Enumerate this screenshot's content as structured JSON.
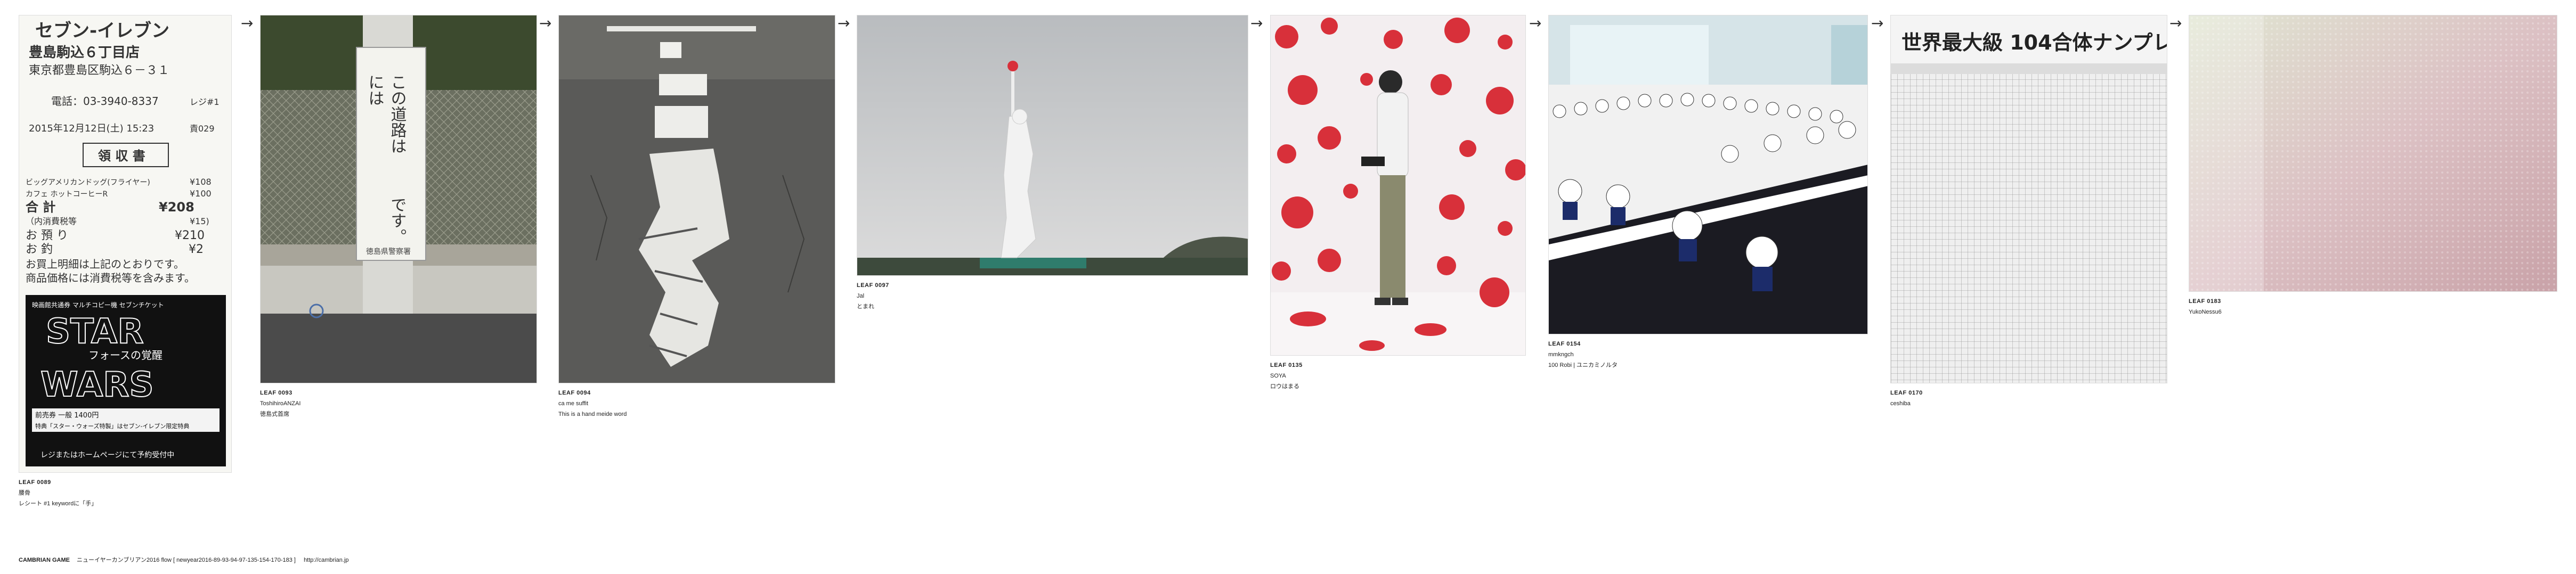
{
  "leaves": [
    {
      "id": "LEAF 0089",
      "user": "腰骨",
      "text": "レシート #1 keywordに「手」"
    },
    {
      "id": "LEAF 0093",
      "user": "ToshihiroANZAI",
      "text": "徳島式首席"
    },
    {
      "id": "LEAF 0094",
      "user": "ca me suffit",
      "text": "This is a hand meide word"
    },
    {
      "id": "LEAF 0097",
      "user": "Jal",
      "text": "とまれ"
    },
    {
      "id": "LEAF 0135",
      "user": "SOYA",
      "text": "ロウはまる"
    },
    {
      "id": "LEAF 0154",
      "user": "mmkngch",
      "text": "100 Robi | ユニカミノルタ"
    },
    {
      "id": "LEAF 0170",
      "user": "ceshiba",
      "text": ""
    },
    {
      "id": "LEAF 0183",
      "user": "YukoNessu6",
      "text": ""
    }
  ],
  "arrow_glyph": "→",
  "receipt": {
    "store": "セブン-イレブン",
    "branch": "豊島駒込６丁目店",
    "address": "東京都豊島区駒込６－３１",
    "phone": "電話：03-3940-8337",
    "register": "レジ#1",
    "datetime": "2015年12月12日(土) 15:23",
    "staff": "責029",
    "title": "領 収 書",
    "items": [
      {
        "name": "ビッグアメリカンドッグ(フライヤー)",
        "price": "¥108"
      },
      {
        "name": "カフェ ホットコーヒーR",
        "price": "¥100"
      }
    ],
    "total_label": "合 計",
    "total": "¥208",
    "tax_label": "（内消費税等",
    "tax": "¥15)",
    "paid_label": "お 預 り",
    "paid": "¥210",
    "change_label": "お 釣",
    "change": "¥2",
    "note1": "お買上明細は上記のとおりです。",
    "note2": "商品価格には消費税等を含みます。",
    "ad_top": "映画館共通券 マルチコピー機 セブンチケット",
    "ad_star": "STAR",
    "ad_sub": "フォースの覚醒",
    "ad_wars": "WARS",
    "ad_line1": "前売券 一般 1400円",
    "ad_line2": "特典「スター・ウォーズ特製」はセブン-イレブン限定特典",
    "ad_line3": "レジまたはホームページにて予約受付中"
  },
  "sign": {
    "line1": "この道路は",
    "line2": "には",
    "line3": "です。",
    "footer": "徳島県警察署"
  },
  "photo_wall1": "世界最大級 104合体ナンプレ",
  "footer": {
    "brand": "CAMBRIAN GAME",
    "title": "ニューイヤーカンブリアン2016 flow [ newyear2016-89-93-94-97-135-154-170-183 ]",
    "url": "http://cambrian.jp"
  },
  "colors": {
    "accent_red": "#d8303a",
    "text": "#222222"
  }
}
